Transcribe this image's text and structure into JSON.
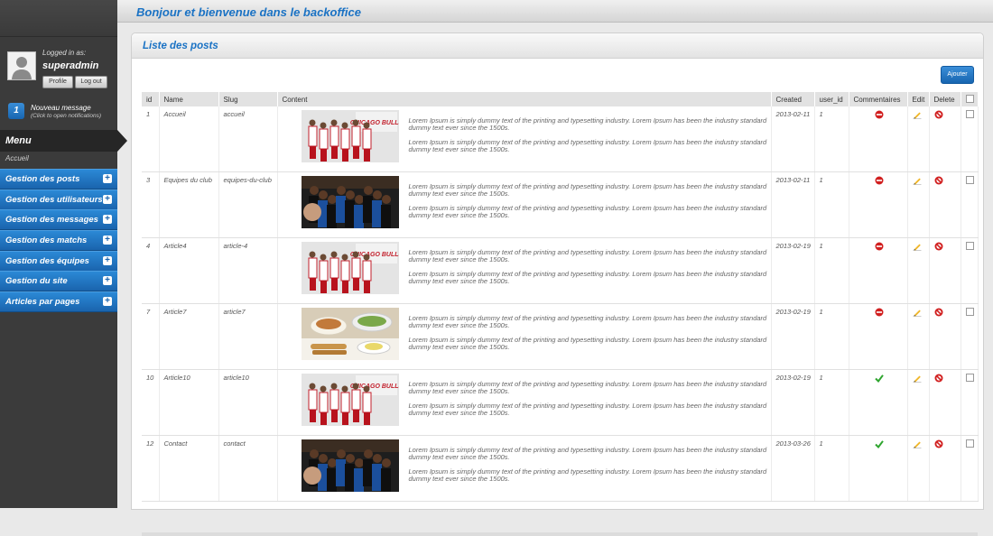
{
  "header": {
    "title": "Bonjour et bienvenue dans le backoffice"
  },
  "user": {
    "logged_label": "Logged in as:",
    "username": "superadmin",
    "profile_label": "Profile",
    "logout_label": "Log out"
  },
  "notification": {
    "count": "1",
    "title": "Nouveau message",
    "subtitle": "(Click to open notifications)"
  },
  "menu": {
    "title": "Menu",
    "current": "Accueil",
    "items": [
      {
        "label": "Gestion des posts"
      },
      {
        "label": "Gestion des utilisateurs"
      },
      {
        "label": "Gestion des messages"
      },
      {
        "label": "Gestion des matchs"
      },
      {
        "label": "Gestion des équipes"
      },
      {
        "label": "Gestion du site"
      },
      {
        "label": "Articles par pages"
      }
    ]
  },
  "panel": {
    "title": "Liste des posts",
    "add_label": "Ajouter"
  },
  "table": {
    "columns": [
      "id",
      "Name",
      "Slug",
      "Content",
      "Created",
      "user_id",
      "Commentaires",
      "Edit",
      "Delete"
    ],
    "content_text": "Lorem Ipsum is simply dummy text of the printing and typesetting industry. Lorem Ipsum has been the industry standard dummy text ever since the 1500s.",
    "rows": [
      {
        "id": "1",
        "name": "Accueil",
        "slug": "accueil",
        "image": "team-photo",
        "created": "2013-02-11",
        "user_id": "1",
        "comments": "disabled-icon"
      },
      {
        "id": "3",
        "name": "Equipes du club",
        "slug": "equipes-du-club",
        "image": "huddle-photo",
        "created": "2013-02-11",
        "user_id": "1",
        "comments": "disabled-icon"
      },
      {
        "id": "4",
        "name": "Article4",
        "slug": "article-4",
        "image": "team-photo",
        "created": "2013-02-19",
        "user_id": "1",
        "comments": "disabled-icon"
      },
      {
        "id": "7",
        "name": "Article7",
        "slug": "article7",
        "image": "food-photo",
        "created": "2013-02-19",
        "user_id": "1",
        "comments": "disabled-icon"
      },
      {
        "id": "10",
        "name": "Article10",
        "slug": "article10",
        "image": "team-photo",
        "created": "2013-02-19",
        "user_id": "1",
        "comments": "enabled-check-icon"
      },
      {
        "id": "12",
        "name": "Contact",
        "slug": "contact",
        "image": "huddle-photo",
        "created": "2013-03-26",
        "user_id": "1",
        "comments": "enabled-check-icon"
      }
    ]
  },
  "images": {
    "banner_text": "CHICAGO BULLS"
  },
  "colors": {
    "accent": "#1a72c4",
    "menu_blue": "#2b89d6",
    "sidebar": "#3b3b3b",
    "disabled_red": "#d11f1f",
    "enabled_green": "#2fa52f"
  }
}
